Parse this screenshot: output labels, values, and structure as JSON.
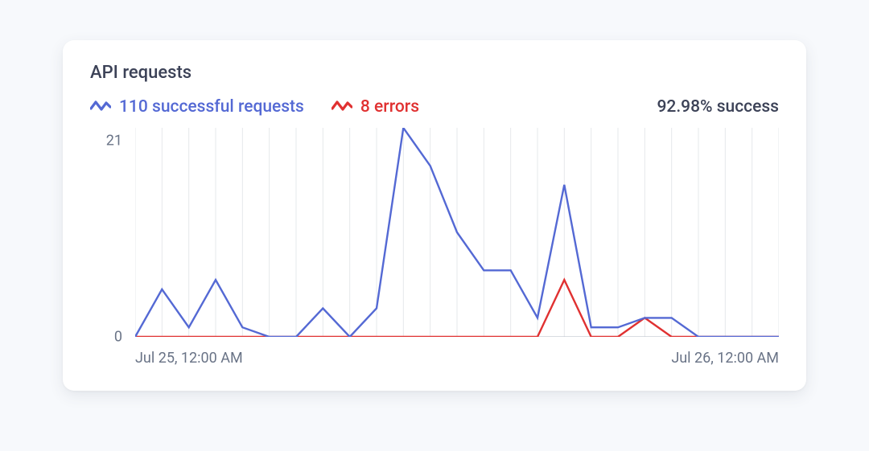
{
  "title": "API requests",
  "legend": {
    "success_label": "110 successful requests",
    "error_label": "8 errors",
    "success_rate": "92.98% success"
  },
  "colors": {
    "success": "#5469d4",
    "error": "#e03131",
    "text": "#3c4257",
    "muted": "#697386"
  },
  "yaxis": {
    "max_label": "21",
    "zero_label": "0"
  },
  "xaxis": {
    "left": "Jul 25, 12:00 AM",
    "right": "Jul 26, 12:00 AM"
  },
  "chart_data": {
    "type": "line",
    "title": "API requests",
    "xlabel": "",
    "ylabel": "",
    "ylim": [
      0,
      22
    ],
    "x": [
      0,
      1,
      2,
      3,
      4,
      5,
      6,
      7,
      8,
      9,
      10,
      11,
      12,
      13,
      14,
      15,
      16,
      17,
      18,
      19,
      20,
      21,
      22,
      23,
      24
    ],
    "x_tick_labels": {
      "0": "Jul 25, 12:00 AM",
      "24": "Jul 26, 12:00 AM"
    },
    "y_tick_labels": [
      0,
      21
    ],
    "series": [
      {
        "name": "successful requests",
        "color": "#5469d4",
        "values": [
          0,
          5,
          1,
          6,
          1,
          0,
          0,
          3,
          0,
          3,
          22,
          18,
          11,
          7,
          7,
          2,
          16,
          1,
          1,
          2,
          2,
          0,
          0,
          0,
          0
        ]
      },
      {
        "name": "errors",
        "color": "#e03131",
        "values": [
          0,
          0,
          0,
          0,
          0,
          0,
          0,
          0,
          0,
          0,
          0,
          0,
          0,
          0,
          0,
          0,
          6,
          0,
          0,
          2,
          0,
          0,
          0,
          0,
          0
        ]
      }
    ],
    "totals": {
      "successful_requests": 110,
      "errors": 8,
      "success_rate_pct": 92.98
    }
  }
}
